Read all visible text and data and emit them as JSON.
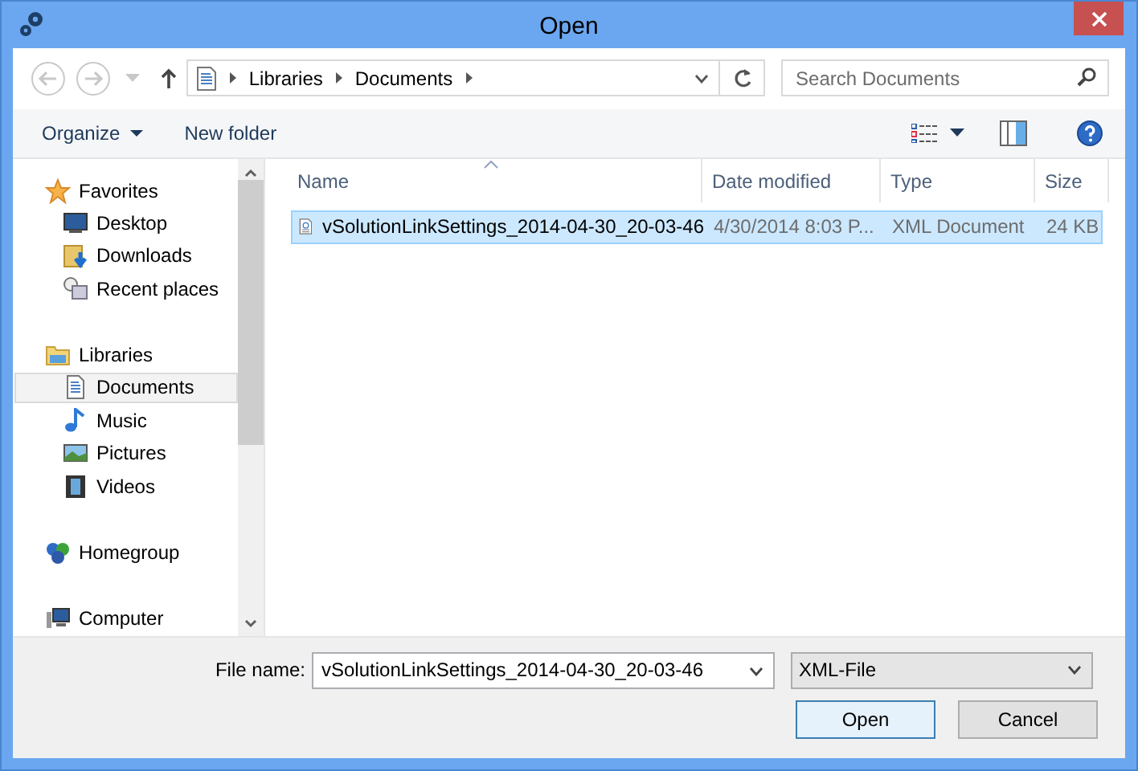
{
  "window": {
    "title": "Open"
  },
  "navigation": {
    "back": {
      "disabled": true
    },
    "forward": {
      "disabled": true
    }
  },
  "address": {
    "path": [
      "Libraries",
      "Documents"
    ]
  },
  "search": {
    "placeholder": "Search Documents"
  },
  "toolbar": {
    "buttons": [
      {
        "label": "Organize",
        "dropdown": true
      },
      {
        "label": "New folder",
        "dropdown": false
      }
    ]
  },
  "sidebar": {
    "items": [
      {
        "label": "Favorites",
        "kind": "star",
        "selected": false,
        "children": [
          {
            "label": "Desktop",
            "kind": "desktop",
            "selected": false
          },
          {
            "label": "Downloads",
            "kind": "downloads",
            "selected": false
          },
          {
            "label": "Recent places",
            "kind": "recent",
            "selected": false
          }
        ]
      },
      {
        "label": "Libraries",
        "kind": "folder",
        "selected": false,
        "children": [
          {
            "label": "Documents",
            "kind": "document",
            "selected": true
          },
          {
            "label": "Music",
            "kind": "music",
            "selected": false
          },
          {
            "label": "Pictures",
            "kind": "pictures",
            "selected": false
          },
          {
            "label": "Videos",
            "kind": "videos",
            "selected": false
          }
        ]
      },
      {
        "label": "Homegroup",
        "kind": "homegroup",
        "selected": false
      },
      {
        "label": "Computer",
        "kind": "computer",
        "selected": false
      }
    ]
  },
  "file_list": {
    "columns": [
      {
        "label": "Name",
        "sorted": true
      },
      {
        "label": "Date modified",
        "sorted": false
      },
      {
        "label": "Type",
        "sorted": false
      },
      {
        "label": "Size",
        "sorted": false
      }
    ],
    "rows": [
      {
        "selected": true,
        "cells": [
          "vSolutionLinkSettings_2014-04-30_20-03-46",
          "4/30/2014 8:03 P...",
          "XML Document",
          "24 KB"
        ]
      }
    ]
  },
  "footer": {
    "file_name_label": "File name:",
    "file_name": "vSolutionLinkSettings_2014-04-30_20-03-46",
    "file_type": "XML-File",
    "buttons": [
      {
        "label": "Open",
        "default": true
      },
      {
        "label": "Cancel",
        "default": false
      }
    ]
  }
}
